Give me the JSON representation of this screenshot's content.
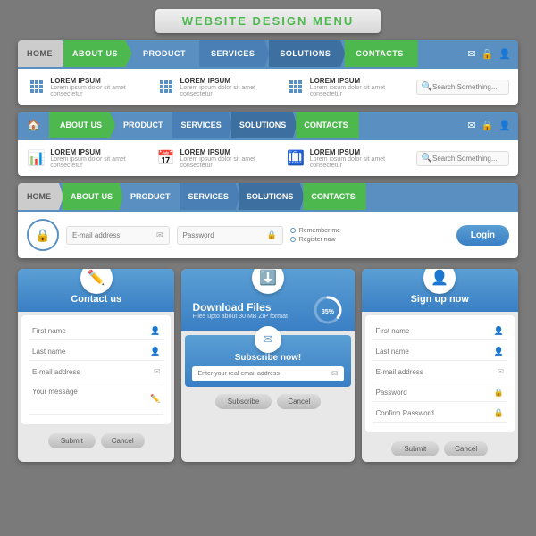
{
  "title": {
    "line1": "WEBSITE",
    "line2": "DESIGN",
    "line3": "MENU"
  },
  "nav1": {
    "home": "HOME",
    "about": "ABOUT US",
    "product": "PRODUCT",
    "services": "SERVICES",
    "solutions": "SOLUTIONS",
    "contacts": "CONTACTS"
  },
  "nav2": {
    "about": "ABOUT US",
    "product": "PRODUCT",
    "services": "SERVICES",
    "solutions": "SOLUTIONS",
    "contacts": "CONTACTS"
  },
  "nav3": {
    "home": "HOME",
    "about": "ABOUT US",
    "product": "PRODUCT",
    "services": "SERVICES",
    "solutions": "SOLUTIONS",
    "contacts": "CONTACTS"
  },
  "content_blocks": {
    "lorem1": "LOREM IPSUM",
    "lorem_sub": "Lorem ipsum dolor sit amet consectetur",
    "search_placeholder": "Search Something..."
  },
  "login": {
    "email_placeholder": "E-mail address",
    "password_placeholder": "Password",
    "remember": "Remember me",
    "register": "Register now",
    "button": "Login"
  },
  "contact": {
    "title": "Contact us",
    "first_name": "First name",
    "last_name": "Last name",
    "email": "E-mail address",
    "message": "Your message",
    "submit": "Submit",
    "cancel": "Cancel"
  },
  "download": {
    "title": "Download Files",
    "subtitle": "Files upto about 30 MB ZIP format",
    "progress": "35%",
    "subscribe_title": "Subscribe now!",
    "subscribe_placeholder": "Enter your real email address",
    "subscribe_btn": "Subscribe",
    "cancel": "Cancel"
  },
  "signup": {
    "title": "Sign up now",
    "first_name": "First name",
    "last_name": "Last name",
    "email": "E-mail address",
    "password": "Password",
    "confirm": "Confirm Password",
    "submit": "Submit",
    "cancel": "Cancel"
  }
}
